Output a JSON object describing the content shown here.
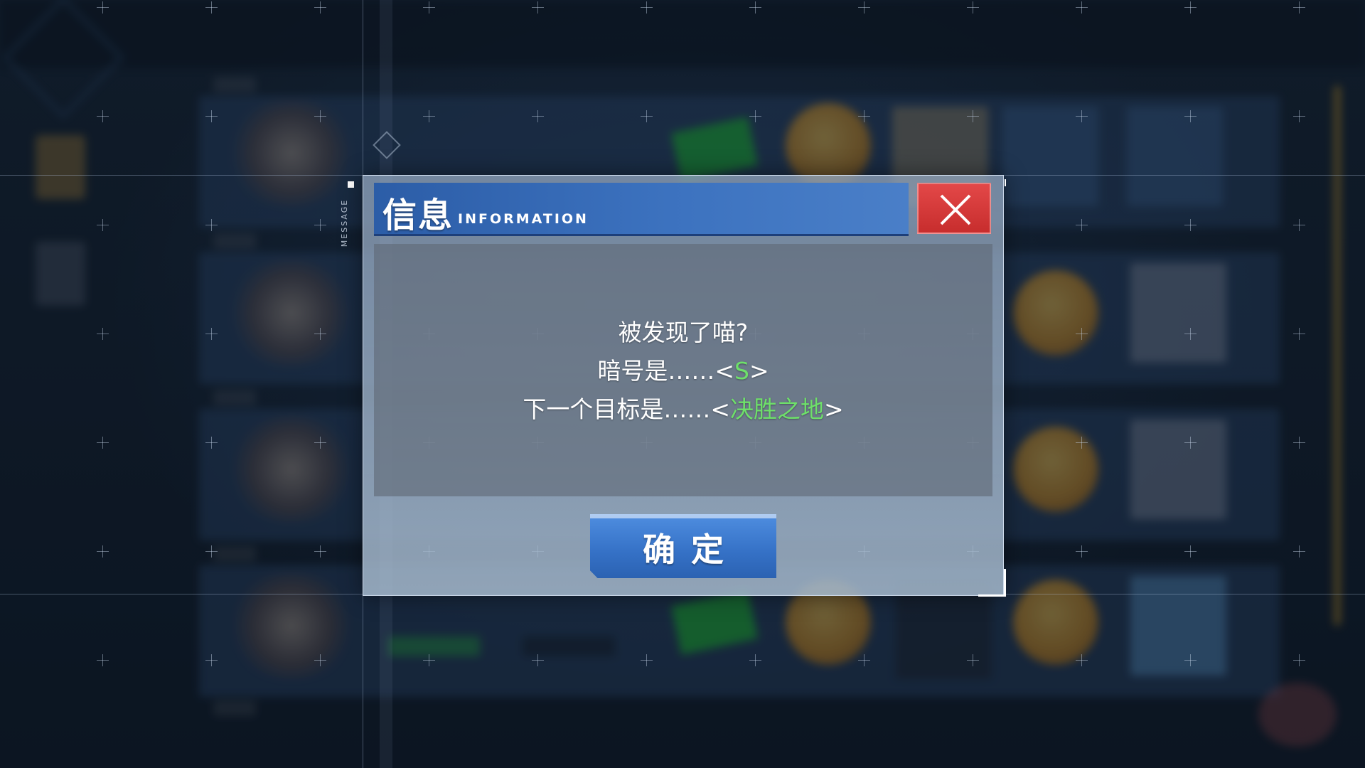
{
  "dialog": {
    "side_label": "MESSAGE",
    "title_cn": "信息",
    "title_en": "INFORMATION",
    "close_icon": "close-icon",
    "message_lines": [
      {
        "pre": "被发现了喵?",
        "highlight": "",
        "post": ""
      },
      {
        "pre": "暗号是……<",
        "highlight": "S",
        "post": ">"
      },
      {
        "pre": "下一个目标是……<",
        "highlight": "决胜之地",
        "post": ">"
      }
    ],
    "confirm_label": "确定"
  },
  "colors": {
    "title_bar": "#3c72bf",
    "close_button": "#d83a3a",
    "highlight_text": "#6ee06a",
    "confirm_button": "#3571c6"
  }
}
